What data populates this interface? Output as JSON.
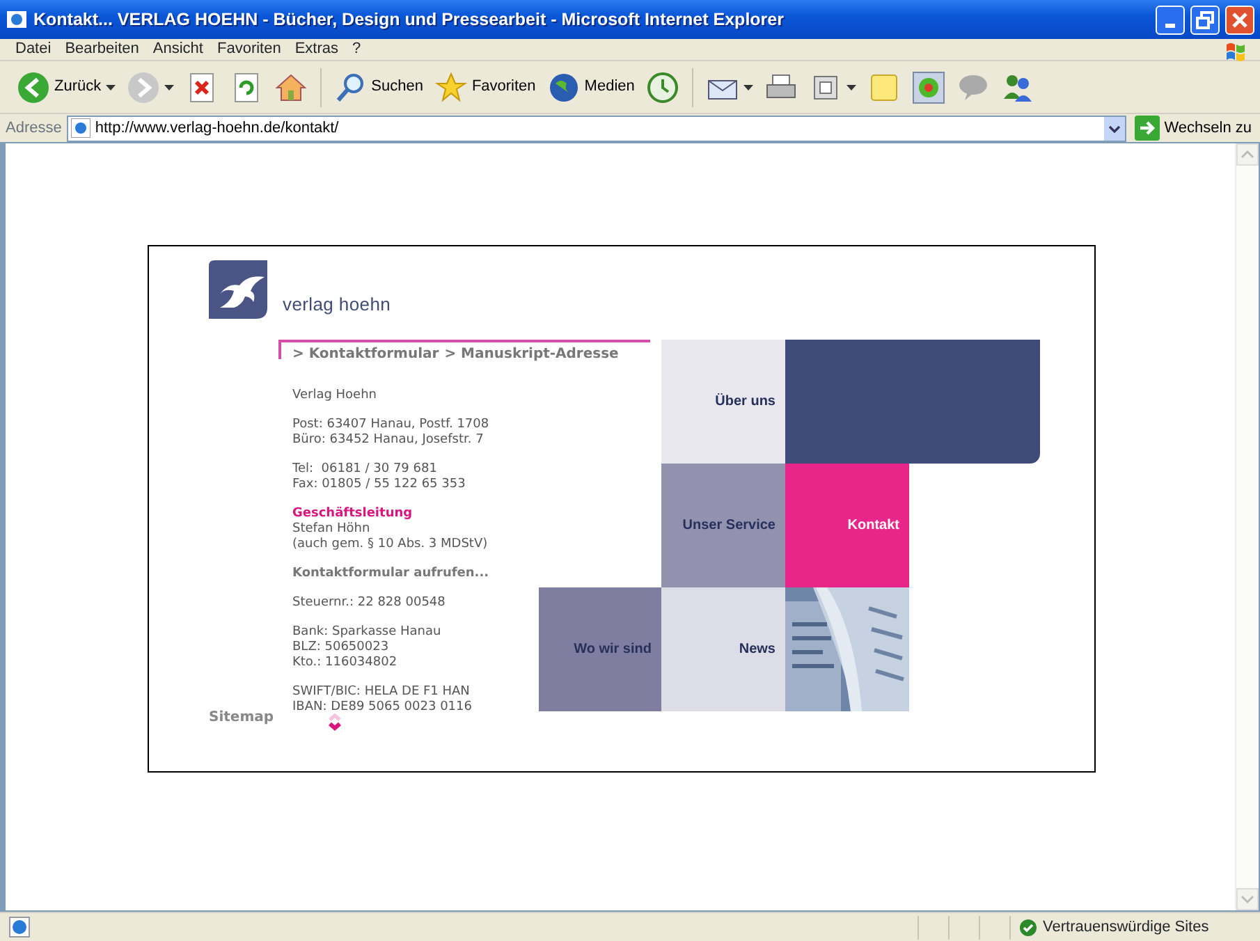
{
  "window": {
    "title": "Kontakt... VERLAG HOEHN - Bücher, Design und Pressearbeit - Microsoft Internet Explorer"
  },
  "menu": [
    "Datei",
    "Bearbeiten",
    "Ansicht",
    "Favoriten",
    "Extras",
    "?"
  ],
  "toolbar": [
    "Zurück",
    "Suchen",
    "Favoriten",
    "Medien"
  ],
  "address_bar": {
    "label": "Adresse",
    "url": "http://www.verlag-hoehn.de/kontakt/",
    "go_label": "Wechseln zu"
  },
  "page": {
    "logo_text": "verlag hoehn",
    "breadcrumb": [
      "> Kontaktformular",
      "> Manuskript-Adresse"
    ],
    "blocks": [
      [
        {
          "kind": "text",
          "text": "Verlag Hoehn"
        }
      ],
      [
        {
          "kind": "text",
          "text": "Post: 63407 Hanau, Postf. 1708"
        },
        {
          "kind": "text",
          "text": "Büro: 63452 Hanau, Josefstr. 7"
        }
      ],
      [
        {
          "kind": "text",
          "text": "Tel:  06181 / 30 79 681"
        },
        {
          "kind": "text",
          "text": "Fax: 01805 / 55 122 65 353"
        }
      ],
      [
        {
          "kind": "heading",
          "text": "Geschäftsleitung"
        },
        {
          "kind": "text",
          "text": "Stefan Höhn"
        },
        {
          "kind": "text",
          "text": "(auch gem. § 10 Abs. 3 MDStV)"
        }
      ],
      [
        {
          "kind": "link",
          "text": "Kontaktformular aufrufen..."
        }
      ],
      [
        {
          "kind": "text",
          "text": "Steuernr.: 22 828 00548"
        }
      ],
      [
        {
          "kind": "text",
          "text": "Bank: Sparkasse Hanau"
        },
        {
          "kind": "text",
          "text": "BLZ: 50650023"
        },
        {
          "kind": "text",
          "text": "Kto.: 116034802"
        }
      ],
      [
        {
          "kind": "text",
          "text": "SWIFT/BIC: HELA DE F1 HAN"
        },
        {
          "kind": "text",
          "text": "IBAN: DE89 5065 0023 0116"
        }
      ]
    ],
    "tiles": [
      {
        "kind": "link",
        "label": "Über uns",
        "color": "#e9e8ef",
        "selected": false
      },
      {
        "kind": "block",
        "color": "#3f4b78"
      },
      {
        "kind": "link",
        "label": "Unser Service",
        "color": "#9291ae",
        "selected": false
      },
      {
        "kind": "link",
        "label": "Kontakt",
        "color": "#e8268a",
        "selected": true
      },
      {
        "kind": "link",
        "label": "Wo wir sind",
        "color": "#7f7ea0",
        "selected": false
      },
      {
        "kind": "link",
        "label": "News",
        "color": "#dcdde6",
        "selected": false
      },
      {
        "kind": "picture"
      }
    ],
    "sitemap": "Sitemap"
  },
  "status_bar": {
    "zone": "Vertrauenswürdige Sites"
  }
}
